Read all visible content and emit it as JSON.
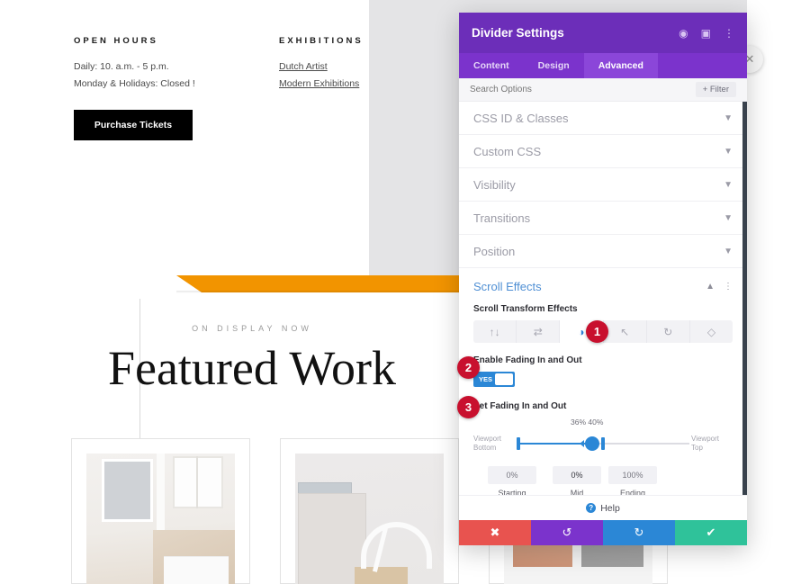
{
  "page": {
    "open_hours": {
      "title": "OPEN HOURS",
      "lines": [
        "Daily: 10. a.m. - 5 p.m.",
        "Monday & Holidays: Closed !"
      ]
    },
    "exhibitions": {
      "title": "EXHIBITIONS",
      "links": [
        "Dutch Artist",
        "Modern Exhibitions"
      ]
    },
    "purchase_button": "Purchase Tickets",
    "featured": {
      "eyebrow": "ON DISPLAY NOW",
      "title": "Featured Work"
    }
  },
  "modal": {
    "title": "Divider Settings",
    "header_icons": [
      "responsive-view-icon",
      "layout-columns-icon",
      "more-options-icon"
    ],
    "close_circle_icon": "close-icon",
    "tabs": [
      {
        "label": "Content",
        "active": false
      },
      {
        "label": "Design",
        "active": false
      },
      {
        "label": "Advanced",
        "active": true
      }
    ],
    "search": {
      "placeholder": "Search Options",
      "value": "",
      "filter_label": "+ Filter"
    },
    "accordions": [
      {
        "label": "CSS ID & Classes"
      },
      {
        "label": "Custom CSS"
      },
      {
        "label": "Visibility"
      },
      {
        "label": "Transitions"
      },
      {
        "label": "Position"
      }
    ],
    "scroll_effects": {
      "section_title": "Scroll Effects",
      "collapse_icon": "chevron-up-icon",
      "options_icon": "more-options-icon",
      "transform_label": "Scroll Transform Effects",
      "transform_icons": [
        {
          "name": "vertical-motion-icon",
          "glyph": "↑↓",
          "active": false
        },
        {
          "name": "horizontal-motion-icon",
          "glyph": "⇄",
          "active": false
        },
        {
          "name": "fading-icon",
          "glyph": "◑",
          "active": true
        },
        {
          "name": "scaling-icon",
          "glyph": "↖",
          "active": false
        },
        {
          "name": "rotating-icon",
          "glyph": "↻",
          "active": false
        },
        {
          "name": "blur-icon",
          "glyph": "◇",
          "active": false
        }
      ],
      "enable_label": "Enable Fading In and Out",
      "toggle_value": "YES",
      "set_label": "Set Fading In and Out",
      "slider": {
        "start_caption": "Viewport\nBottom",
        "end_caption": "Viewport\nTop",
        "value_labels": "36% 40%",
        "mid_value": "36%",
        "end_value": "40%"
      },
      "opacities": [
        {
          "value": "0%",
          "label": "Starting\nOpacity"
        },
        {
          "value": "0%",
          "label": "Mid\nOpacity"
        },
        {
          "value": "100%",
          "label": "Ending\nOpacity"
        }
      ]
    },
    "help_label": "Help",
    "actions": [
      {
        "name": "discard-button",
        "glyph": "✖",
        "color": "#e8534f"
      },
      {
        "name": "undo-button",
        "glyph": "↺",
        "color": "#7b33cc"
      },
      {
        "name": "redo-button",
        "glyph": "↻",
        "color": "#2b87d6"
      },
      {
        "name": "save-button",
        "glyph": "✔",
        "color": "#2fc29a"
      }
    ]
  },
  "badges": {
    "one": "1",
    "two": "2",
    "three": "3"
  }
}
